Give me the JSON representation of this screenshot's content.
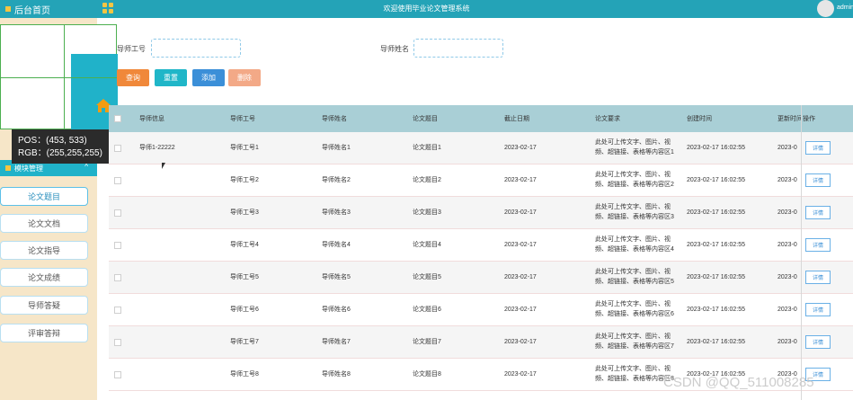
{
  "header": {
    "sidebar_title": "后台首页",
    "title": "欢迎使用毕业论文管理系统",
    "user_name": "admin"
  },
  "picker": {
    "pos_text": "POS：(453, 533)",
    "rgb_text": "RGB：(255,255,255)"
  },
  "sidebar": {
    "module_title": "模块管理",
    "items": [
      {
        "label": "论文题目"
      },
      {
        "label": "论文文档"
      },
      {
        "label": "论文指导"
      },
      {
        "label": "论文成绩"
      },
      {
        "label": "导师答疑"
      },
      {
        "label": "评审答辩"
      }
    ]
  },
  "search": {
    "teacher_no_label": "导师工号",
    "teacher_no_value": "",
    "teacher_name_label": "导师姓名",
    "teacher_name_value": ""
  },
  "toolbar": {
    "query": "查询",
    "reset": "重置",
    "add": "添加",
    "delete": "删除"
  },
  "colors": {
    "teal": "#24a3b7",
    "query": "#f0883a",
    "reset": "#20b6c8",
    "add": "#3b8fd8",
    "delete": "#f3a987"
  },
  "table": {
    "headers": [
      "导师信息",
      "导师工号",
      "导师姓名",
      "论文题目",
      "截止日期",
      "论文要求",
      "创建时间",
      "更新时间",
      "操作"
    ],
    "rows": [
      {
        "info": "导师1-22222",
        "no": "导师工号1",
        "name": "导师姓名1",
        "topic": "论文题目1",
        "deadline": "2023-02-17",
        "req1": "此处可上传文字、图片、视",
        "req2": "频、超链接、表格等内容区1",
        "created": "2023-02-17 16:02:55",
        "updated": "2023-0",
        "action": "详情"
      },
      {
        "info": "",
        "no": "导师工号2",
        "name": "导师姓名2",
        "topic": "论文题目2",
        "deadline": "2023-02-17",
        "req1": "此处可上传文字、图片、视",
        "req2": "频、超链接、表格等内容区2",
        "created": "2023-02-17 16:02:55",
        "updated": "2023-0",
        "action": "详情"
      },
      {
        "info": "",
        "no": "导师工号3",
        "name": "导师姓名3",
        "topic": "论文题目3",
        "deadline": "2023-02-17",
        "req1": "此处可上传文字、图片、视",
        "req2": "频、超链接、表格等内容区3",
        "created": "2023-02-17 16:02:55",
        "updated": "2023-0",
        "action": "详情"
      },
      {
        "info": "",
        "no": "导师工号4",
        "name": "导师姓名4",
        "topic": "论文题目4",
        "deadline": "2023-02-17",
        "req1": "此处可上传文字、图片、视",
        "req2": "频、超链接、表格等内容区4",
        "created": "2023-02-17 16:02:55",
        "updated": "2023-0",
        "action": "详情"
      },
      {
        "info": "",
        "no": "导师工号5",
        "name": "导师姓名5",
        "topic": "论文题目5",
        "deadline": "2023-02-17",
        "req1": "此处可上传文字、图片、视",
        "req2": "频、超链接、表格等内容区5",
        "created": "2023-02-17 16:02:55",
        "updated": "2023-0",
        "action": "详情"
      },
      {
        "info": "",
        "no": "导师工号6",
        "name": "导师姓名6",
        "topic": "论文题目6",
        "deadline": "2023-02-17",
        "req1": "此处可上传文字、图片、视",
        "req2": "频、超链接、表格等内容区6",
        "created": "2023-02-17 16:02:55",
        "updated": "2023-0",
        "action": "详情"
      },
      {
        "info": "",
        "no": "导师工号7",
        "name": "导师姓名7",
        "topic": "论文题目7",
        "deadline": "2023-02-17",
        "req1": "此处可上传文字、图片、视",
        "req2": "频、超链接、表格等内容区7",
        "created": "2023-02-17 16:02:55",
        "updated": "2023-0",
        "action": "详情"
      },
      {
        "info": "",
        "no": "导师工号8",
        "name": "导师姓名8",
        "topic": "论文题目8",
        "deadline": "2023-02-17",
        "req1": "此处可上传文字、图片、视",
        "req2": "频、超链接、表格等内容区8",
        "created": "2023-02-17 16:02:55",
        "updated": "2023-0",
        "action": "详情"
      }
    ]
  },
  "watermark": "CSDN @QQ_511008285"
}
